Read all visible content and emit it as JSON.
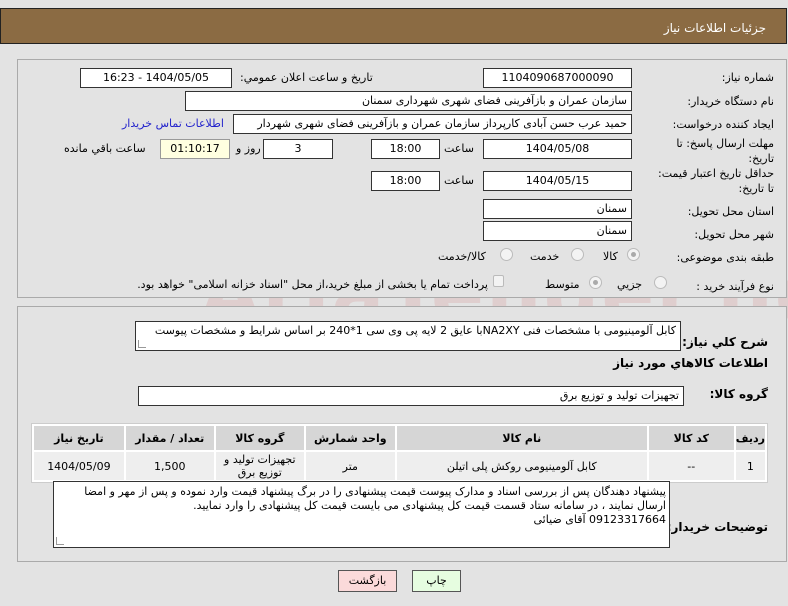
{
  "header": {
    "title": "جزئیات اطلاعات نیاز"
  },
  "form": {
    "need_number_label": "شماره نیاز:",
    "need_number": "1104090687000090",
    "announce_label": "تاریخ و ساعت اعلان عمومي:",
    "announce_value": "1404/05/05 - 16:23",
    "buyer_org_label": "نام دستگاه خریدار:",
    "buyer_org": "سازمان عمران و بازآفرینی فضای شهری شهرداری سمنان",
    "creator_label": "ایجاد کننده درخواست:",
    "creator": "حمید عرب حسن آبادی کارپرداز سازمان عمران و بازآفرینی فضای شهری شهردار",
    "contact_link": "اطلاعات تماس خریدار",
    "deadline_label": "مهلت ارسال پاسخ: تا تاریخ:",
    "deadline_date": "1404/05/08",
    "time_label": "ساعت",
    "deadline_time": "18:00",
    "days": "3",
    "days_label": "روز و",
    "remaining": "01:10:17",
    "remaining_label": "ساعت باقي مانده",
    "validity_label": "حداقل تاریخ اعتبار قیمت: تا تاریخ:",
    "validity_date": "1404/05/15",
    "validity_time": "18:00",
    "province_label": "استان محل تحویل:",
    "province": "سمنان",
    "city_label": "شهر محل تحویل:",
    "city": "سمنان",
    "category_label": "طبقه بندی موضوعی:",
    "category_options": [
      "کالا",
      "خدمت",
      "کالا/خدمت"
    ],
    "process_label": "نوع فرآیند خرید :",
    "process_options": [
      "جزیي",
      "متوسط"
    ],
    "payment_note": "پرداخت تمام یا بخشی از مبلغ خرید،از محل \"اسناد خزانه اسلامی\" خواهد بود."
  },
  "details": {
    "description_label": "شرح کلي نیاز:",
    "description": "کابل آلومینیومی با مشخصات فنی NA2XYبا عایق 2 لایه پی وی سی 1*240 بر اساس شرایط و مشخصات پیوست",
    "goods_title": "اطلاعات کالاهاي مورد نیاز",
    "group_label": "گروه کالا:",
    "group": "تجهیزات تولید و توزیع برق",
    "table": {
      "headers": [
        "ردیف",
        "کد کالا",
        "نام کالا",
        "واحد شمارش",
        "گروه کالا",
        "تعداد / مقدار",
        "تاریخ نیاز"
      ],
      "rows": [
        [
          "1",
          "--",
          "کابل آلومینیومی روکش پلی اتیلن",
          "متر",
          "تجهیزات تولید و توزیع برق",
          "1,500",
          "1404/05/09"
        ]
      ]
    },
    "notes_label": "توضیحات خریدار:",
    "notes": "پیشنهاد دهندگان پس از بررسی اسناد و مدارک پیوست قیمت  پیشنهادی را در برگ پیشنهاد قیمت وارد نموده و پس از مهر و امضا ارسال نمایند ، در سامانه ستاد قسمت قیمت کل پیشنهادی می بایست قیمت کل پیشنهادی را وارد نمایید.\n09123317664 آقای ضیائی"
  },
  "buttons": {
    "back": "بازگشت",
    "print": "چاپ"
  },
  "colors": {
    "header": "#8b6b43",
    "link": "#2222cc",
    "back_bg": "#fbdada",
    "print_bg": "#e6fde0",
    "timer_bg": "#ffffe0"
  },
  "watermark": "AriaTender.net"
}
